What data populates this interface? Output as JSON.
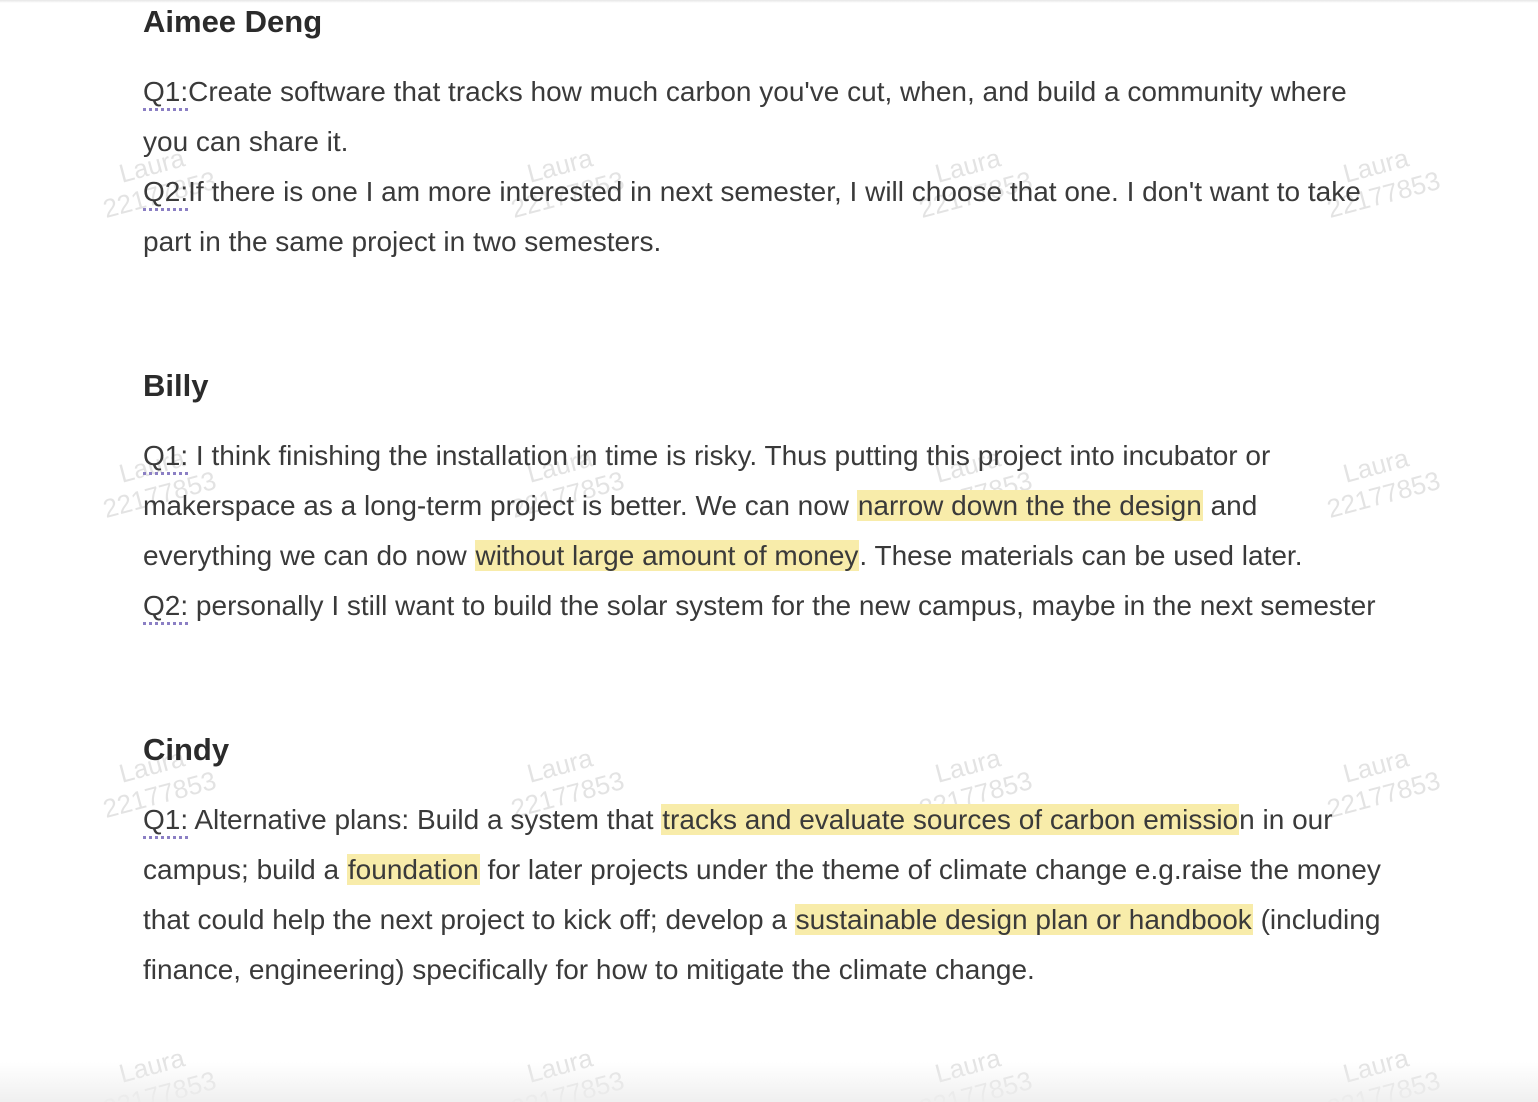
{
  "watermark": {
    "name": "Laura",
    "id": "22177853",
    "color": "#bdbdbd"
  },
  "highlight_color": "#f8ecaa",
  "sections": [
    {
      "name": "Aimee Deng",
      "paragraphs": [
        {
          "label": "Q1:",
          "segments": [
            {
              "text": "Create software that tracks how much carbon you've cut, when, and build a community where you can share it."
            }
          ]
        },
        {
          "label": "Q2:",
          "segments": [
            {
              "text": "If there is one I am more interested in next semester, I will choose that one. I don't want to take part in the same project in two semesters."
            }
          ]
        }
      ]
    },
    {
      "name": "Billy",
      "paragraphs": [
        {
          "label": "Q1:",
          "segments": [
            {
              "text": " I think finishing the installation in time is risky. Thus putting this project into incubator or makerspace as a long-term project is better. We can now "
            },
            {
              "text": "narrow down the the design",
              "highlight": true
            },
            {
              "text": " and everything we can do now "
            },
            {
              "text": "without large amount of money",
              "highlight": true
            },
            {
              "text": ". These materials can be used later."
            }
          ]
        },
        {
          "label": "Q2:",
          "segments": [
            {
              "text": " personally I still want to build the solar system for the new campus, maybe in the next semester"
            }
          ]
        }
      ]
    },
    {
      "name": "Cindy",
      "paragraphs": [
        {
          "label": "Q1:",
          "segments": [
            {
              "text": " Alternative plans: Build a system that "
            },
            {
              "text": "tracks and evaluate sources of carbon emissio",
              "highlight": true
            },
            {
              "text": "n in our campus; build a "
            },
            {
              "text": "foundation",
              "highlight": true
            },
            {
              "text": " for later projects under the theme of climate change e.g.raise the money that could help the next project to kick off; develop a "
            },
            {
              "text": "sustainable design plan or handbook",
              "highlight": true
            },
            {
              "text": " (including finance, engineering) specifically for how to mitigate the climate change."
            }
          ]
        }
      ]
    }
  ]
}
